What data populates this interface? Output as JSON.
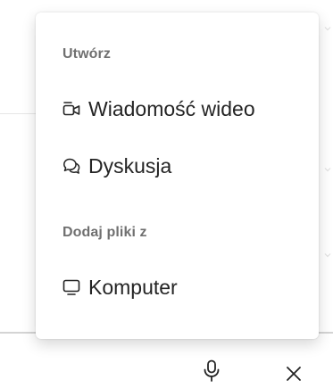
{
  "menu": {
    "create_header": "Utwórz",
    "items_create": [
      {
        "label": "Wiadomość wideo",
        "icon": "video-icon"
      },
      {
        "label": "Dyskusja",
        "icon": "chat-bubbles-icon"
      }
    ],
    "add_files_header": "Dodaj pliki z",
    "items_files": [
      {
        "label": "Komputer",
        "icon": "monitor-icon"
      }
    ]
  },
  "toolbar": {
    "mic_icon": "microphone-icon",
    "close_icon": "close-icon"
  },
  "colors": {
    "text": "#242424",
    "header": "#707070",
    "background": "#ffffff"
  }
}
